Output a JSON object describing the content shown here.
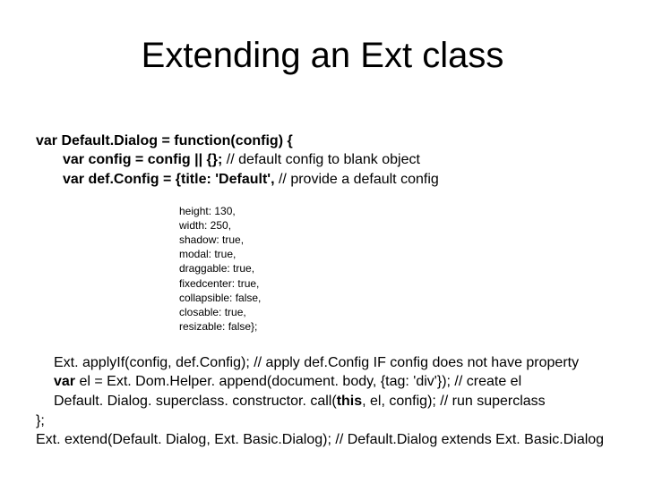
{
  "title": "Extending an Ext class",
  "line1_a": "var",
  "line1_b": " Default.Dialog = ",
  "line1_c": "function",
  "line1_d": "(config) {",
  "line2_a": "var",
  "line2_b": " config = config || {}; ",
  "line2_c": "// default config to blank object",
  "line3_a": "var",
  "line3_b": " def.Config = {title: 'Default', ",
  "line3_c": "// provide a default config",
  "small1": "height: 130,",
  "small2": "width: 250,",
  "small3": "shadow: true,",
  "small4": "modal: true,",
  "small5": "draggable: true,",
  "small6": "fixedcenter: true,",
  "small7": "collapsible: false,",
  "small8": "closable: true,",
  "small9": "resizable: false};",
  "line4_a": "Ext. applyIf(config, def.Config); ",
  "line4_b": "// apply def.Config IF config does not have property",
  "line5_a": "var",
  "line5_b": " el = Ext. Dom.Helper. append(document. body, {tag: 'div'}); ",
  "line5_c": "// create el",
  "line6_a": "Default. Dialog. superclass. constructor. call(",
  "line6_b": "this",
  "line6_c": ", el, config); ",
  "line6_d": "// run superclass",
  "line7": "};",
  "line8_a": "Ext. extend(Default. Dialog, Ext. Basic.Dialog); ",
  "line8_b": "// Default.Dialog extends Ext. Basic.Dialog"
}
